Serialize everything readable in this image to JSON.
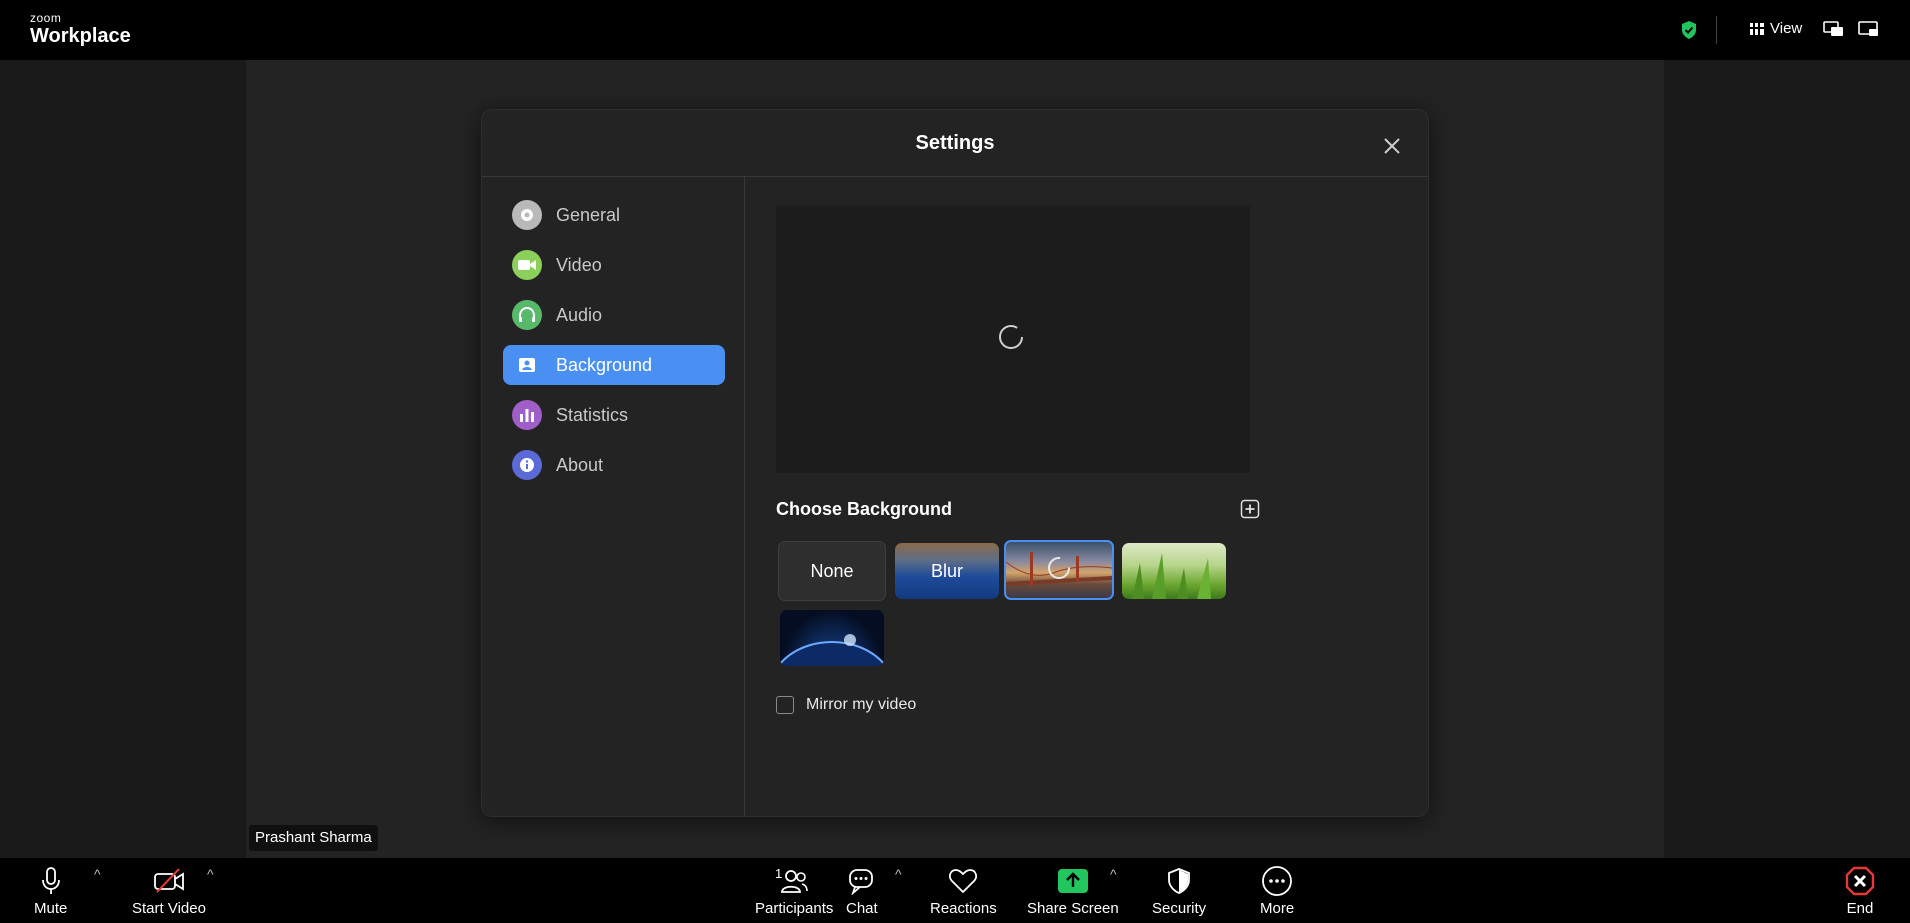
{
  "app": {
    "brand_small": "zoom",
    "brand_big": "Workplace"
  },
  "topbar": {
    "view_label": "View",
    "shield_color": "#21c55d"
  },
  "participant": {
    "name": "Prashant Sharma"
  },
  "settings": {
    "title": "Settings",
    "nav": [
      {
        "label": "General",
        "icon": "gear-icon",
        "color": "#b9b9b9",
        "active": false
      },
      {
        "label": "Video",
        "icon": "video-camera-icon",
        "color": "#8ccf5b",
        "active": false
      },
      {
        "label": "Audio",
        "icon": "headphones-icon",
        "color": "#58b96b",
        "active": false
      },
      {
        "label": "Background",
        "icon": "background-icon",
        "color": "#4a8ff2",
        "active": true
      },
      {
        "label": "Statistics",
        "icon": "bar-chart-icon",
        "color": "#a05ec8",
        "active": false
      },
      {
        "label": "About",
        "icon": "info-icon",
        "color": "#5b6ad6",
        "active": false
      }
    ],
    "choose_background_label": "Choose Background",
    "backgrounds": [
      {
        "label": "None"
      },
      {
        "label": "Blur"
      },
      {
        "label": "",
        "image": "golden-gate-bridge",
        "selected": true
      },
      {
        "label": "",
        "image": "green-grass"
      },
      {
        "label": "",
        "image": "earth-from-space"
      }
    ],
    "mirror_label": "Mirror my video",
    "mirror_checked": false
  },
  "toolbar": {
    "mute": "Mute",
    "start_video": "Start Video",
    "participants": "Participants",
    "participant_count": "1",
    "chat": "Chat",
    "reactions": "Reactions",
    "share_screen": "Share Screen",
    "security": "Security",
    "more": "More",
    "end": "End",
    "share_color": "#22c55e",
    "end_color": "#e53935"
  }
}
